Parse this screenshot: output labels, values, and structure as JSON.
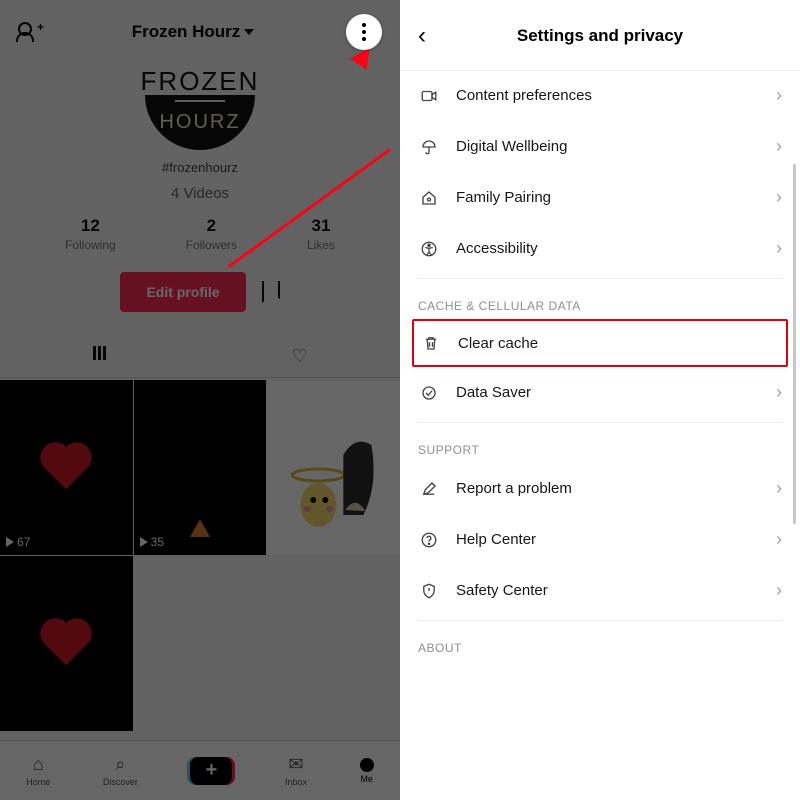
{
  "profile": {
    "header_title": "Frozen Hourz",
    "logo_top": "FROZEN",
    "logo_bottom": "HOURZ",
    "handle": "#frozenhourz",
    "videos_label": "4 Videos",
    "stats": [
      {
        "num": "12",
        "label": "Following"
      },
      {
        "num": "2",
        "label": "Followers"
      },
      {
        "num": "31",
        "label": "Likes"
      }
    ],
    "edit_label": "Edit profile",
    "thumb_plays": [
      "67",
      "35"
    ]
  },
  "nav": {
    "items": [
      "Home",
      "Discover",
      "",
      "Inbox",
      "Me"
    ]
  },
  "settings": {
    "title": "Settings and privacy",
    "rows_top": [
      {
        "label": "Content preferences"
      },
      {
        "label": "Digital Wellbeing"
      },
      {
        "label": "Family Pairing"
      },
      {
        "label": "Accessibility"
      }
    ],
    "section_cache": "CACHE & CELLULAR DATA",
    "clear_cache": "Clear cache",
    "data_saver": "Data Saver",
    "section_support": "SUPPORT",
    "rows_support": [
      {
        "label": "Report a problem"
      },
      {
        "label": "Help Center"
      },
      {
        "label": "Safety Center"
      }
    ],
    "section_about": "ABOUT"
  }
}
